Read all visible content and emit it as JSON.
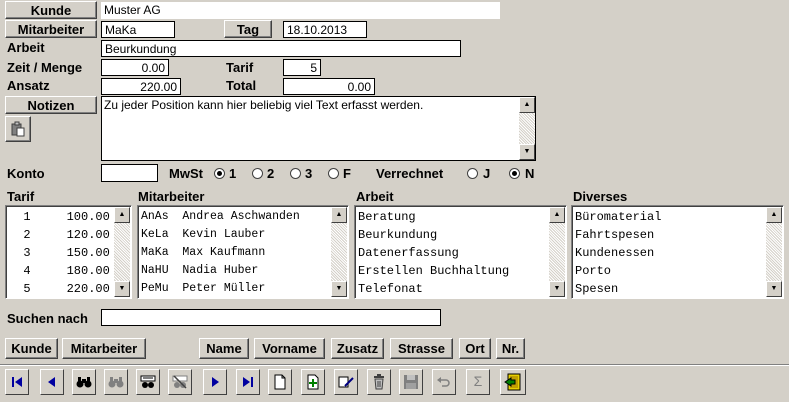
{
  "header": {
    "kunde_label": "Kunde",
    "kunde_value": "Muster AG",
    "mitarbeiter_label": "Mitarbeiter",
    "mitarbeiter_value": "MaKa",
    "tag_label": "Tag",
    "tag_value": "18.10.2013",
    "arbeit_label": "Arbeit",
    "arbeit_value": "Beurkundung",
    "zeit_label": "Zeit / Menge",
    "zeit_value": "0.00",
    "tarif_label": "Tarif",
    "tarif_value": "5",
    "ansatz_label": "Ansatz",
    "ansatz_value": "220.00",
    "total_label": "Total",
    "total_value": "0.00",
    "notizen_label": "Notizen",
    "notizen_value": "Zu jeder Position kann hier beliebig viel Text erfasst werden.",
    "konto_label": "Konto",
    "konto_value": "",
    "mwst_label": "MwSt",
    "mwst_options": [
      "1",
      "2",
      "3",
      "F"
    ],
    "mwst_selected": "1",
    "verrechnet_label": "Verrechnet",
    "verrechnet_options": [
      "J",
      "N"
    ],
    "verrechnet_selected": "N"
  },
  "lists": {
    "tarif_title": "Tarif",
    "tarif_rows": [
      "  1     100.00",
      "  2     120.00",
      "  3     150.00",
      "  4     180.00",
      "  5     220.00"
    ],
    "mitarbeiter_title": "Mitarbeiter",
    "mitarbeiter_rows": [
      "AnAs  Andrea Aschwanden",
      "KeLa  Kevin Lauber",
      "MaKa  Max Kaufmann",
      "NaHU  Nadia Huber",
      "PeMu  Peter Müller"
    ],
    "arbeit_title": "Arbeit",
    "arbeit_rows": [
      "Beratung",
      "Beurkundung",
      "Datenerfassung",
      "Erstellen Buchhaltung",
      "Telefonat"
    ],
    "diverses_title": "Diverses",
    "diverses_rows": [
      "Büromaterial",
      "Fahrtspesen",
      "Kundenessen",
      "Porto",
      "Spesen"
    ]
  },
  "search": {
    "label": "Suchen nach",
    "value": ""
  },
  "sort_buttons": {
    "kunde": "Kunde",
    "mitarbeiter": "Mitarbeiter",
    "name": "Name",
    "vorname": "Vorname",
    "zusatz": "Zusatz",
    "strasse": "Strasse",
    "ort": "Ort",
    "nr": "Nr."
  },
  "toolbar_icons": [
    "first-record-icon",
    "previous-record-icon",
    "find-icon",
    "find-next-icon",
    "filter-icon",
    "remove-filter-icon",
    "next-record-icon",
    "last-record-icon",
    "new-record-icon",
    "add-record-icon",
    "edit-record-icon",
    "delete-icon",
    "save-icon",
    "undo-icon",
    "sum-icon",
    "exit-icon"
  ]
}
